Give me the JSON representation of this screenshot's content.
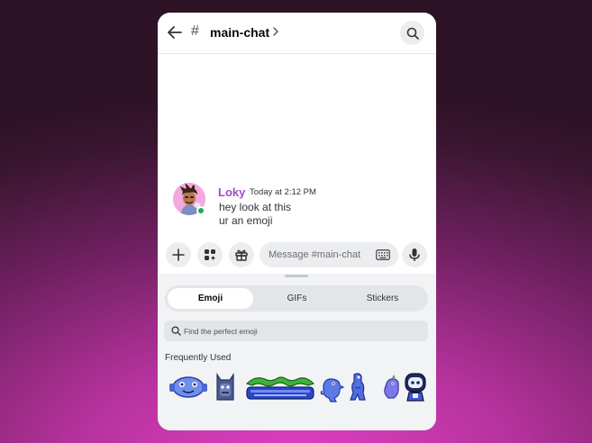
{
  "header": {
    "back_icon": "arrow-left-icon",
    "hash": "#",
    "channel_name": "main-chat",
    "chevron_icon": "chevron-right-icon",
    "search_icon": "search-icon"
  },
  "message": {
    "username": "Loky",
    "timestamp": "Today at 2:12 PM",
    "lines": [
      "hey look at this",
      "ur an emoji"
    ],
    "status": "online",
    "username_color": "#a44bc4",
    "status_color": "#23a55a"
  },
  "composer": {
    "buttons": [
      {
        "icon": "plus-icon"
      },
      {
        "icon": "apps-icon"
      },
      {
        "icon": "gift-icon"
      }
    ],
    "placeholder": "Message #main-chat",
    "keyboard_icon": "keyboard-icon",
    "mic_icon": "microphone-icon"
  },
  "emoji_picker": {
    "tabs": [
      {
        "label": "Emoji",
        "active": true
      },
      {
        "label": "GIFs",
        "active": false
      },
      {
        "label": "Stickers",
        "active": false
      }
    ],
    "search_placeholder": "Find the perfect emoji",
    "section_title": "Frequently Used",
    "emojis": [
      {
        "name": "blue-robot-face-emoji"
      },
      {
        "name": "blue-creature-emoji"
      },
      {
        "name": "green-frog-eyes-emoji"
      },
      {
        "name": "blue-dino-emoji"
      },
      {
        "name": "blue-dino-standing-emoji"
      },
      {
        "name": "purple-dino-emoji"
      },
      {
        "name": "robot-hero-emoji"
      }
    ]
  },
  "colors": {
    "accent": "#5865f2",
    "background_top": "#2e1226",
    "background_bottom": "#e23fc4"
  }
}
